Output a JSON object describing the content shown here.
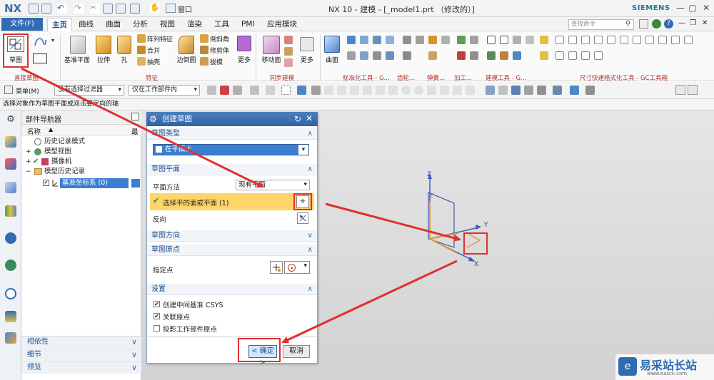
{
  "app": {
    "logo": "NX",
    "window_title": "NX 10 - 建模 - [_model1.prt （修改的）]",
    "brand": "SIEMENS",
    "window_controls": [
      "—",
      "▢",
      "✕"
    ]
  },
  "quick_access": {
    "window_menu": "窗口"
  },
  "menu": {
    "file": "文件(F)",
    "tabs": [
      "主页",
      "曲线",
      "曲面",
      "分析",
      "视图",
      "渲染",
      "工具",
      "PMI",
      "应用模块"
    ],
    "active_tab": "主页",
    "search_placeholder": "查找命令"
  },
  "ribbon": {
    "sketch": "草图",
    "datum_plane": "基准平面",
    "extrude": "拉伸",
    "hole": "孔",
    "pattern_feature": "阵列特征",
    "unite": "合并",
    "shell": "抽壳",
    "edge_blend": "边倒圆",
    "chamfer": "倒斜角",
    "trim_body": "修剪体",
    "draft": "拔模",
    "more1": "更多",
    "move_face": "移动面",
    "more2": "更多",
    "surface": "曲面",
    "groups": {
      "direct_sketch": "直接草图",
      "feature": "特征",
      "sync_modeling": "同步建模",
      "standard_parts": "标准化工具 - G...",
      "gear": "齿轮...",
      "spring": "弹簧...",
      "machining": "加工...",
      "modeling_tools": "建模工具 - G...",
      "dimension_tools": "尺寸快速格式化工具 - GC工具箱"
    }
  },
  "toolbar2": {
    "menu": "菜单(M)",
    "filter": "没有选择过滤器",
    "scope": "仅在工作部件内"
  },
  "status": "选择对象作为草图平面或双击要定向的轴",
  "navigator": {
    "title": "部件导航器",
    "col_name": "名称",
    "col_latest": "最",
    "items": [
      {
        "label": "历史记录模式"
      },
      {
        "label": "模型视图"
      },
      {
        "label": "摄像机"
      },
      {
        "label": "模型历史记录"
      },
      {
        "label": "基准坐标系 (0)"
      }
    ],
    "bottom_panels": [
      "相依性",
      "细节",
      "预览"
    ]
  },
  "dialog": {
    "title": "创建草图",
    "sec_type": "草图类型",
    "type_value": "在平面上",
    "sec_plane": "草图平面",
    "plane_method_label": "平面方法",
    "plane_method_value": "现有平面",
    "select_face": "选择平的面或平面 (1)",
    "reverse": "反向",
    "sec_orient": "草图方向",
    "sec_origin": "草图原点",
    "specify_point": "指定点",
    "sec_settings": "设置",
    "settings": [
      {
        "label": "创建中间基准 CSYS",
        "checked": true
      },
      {
        "label": "关联原点",
        "checked": true
      },
      {
        "label": "投影工作部件原点",
        "checked": false
      }
    ],
    "ok": "< 确定 >",
    "cancel": "取消"
  },
  "csys": {
    "z1": "Z",
    "z2": "Z",
    "y": "Y",
    "x": "X"
  },
  "watermark": {
    "text": "易采站长站",
    "url": "www.easck.com"
  },
  "colors": {
    "accent": "#2f6db3",
    "highlight": "#ffd468",
    "annotation": "#e03030"
  }
}
